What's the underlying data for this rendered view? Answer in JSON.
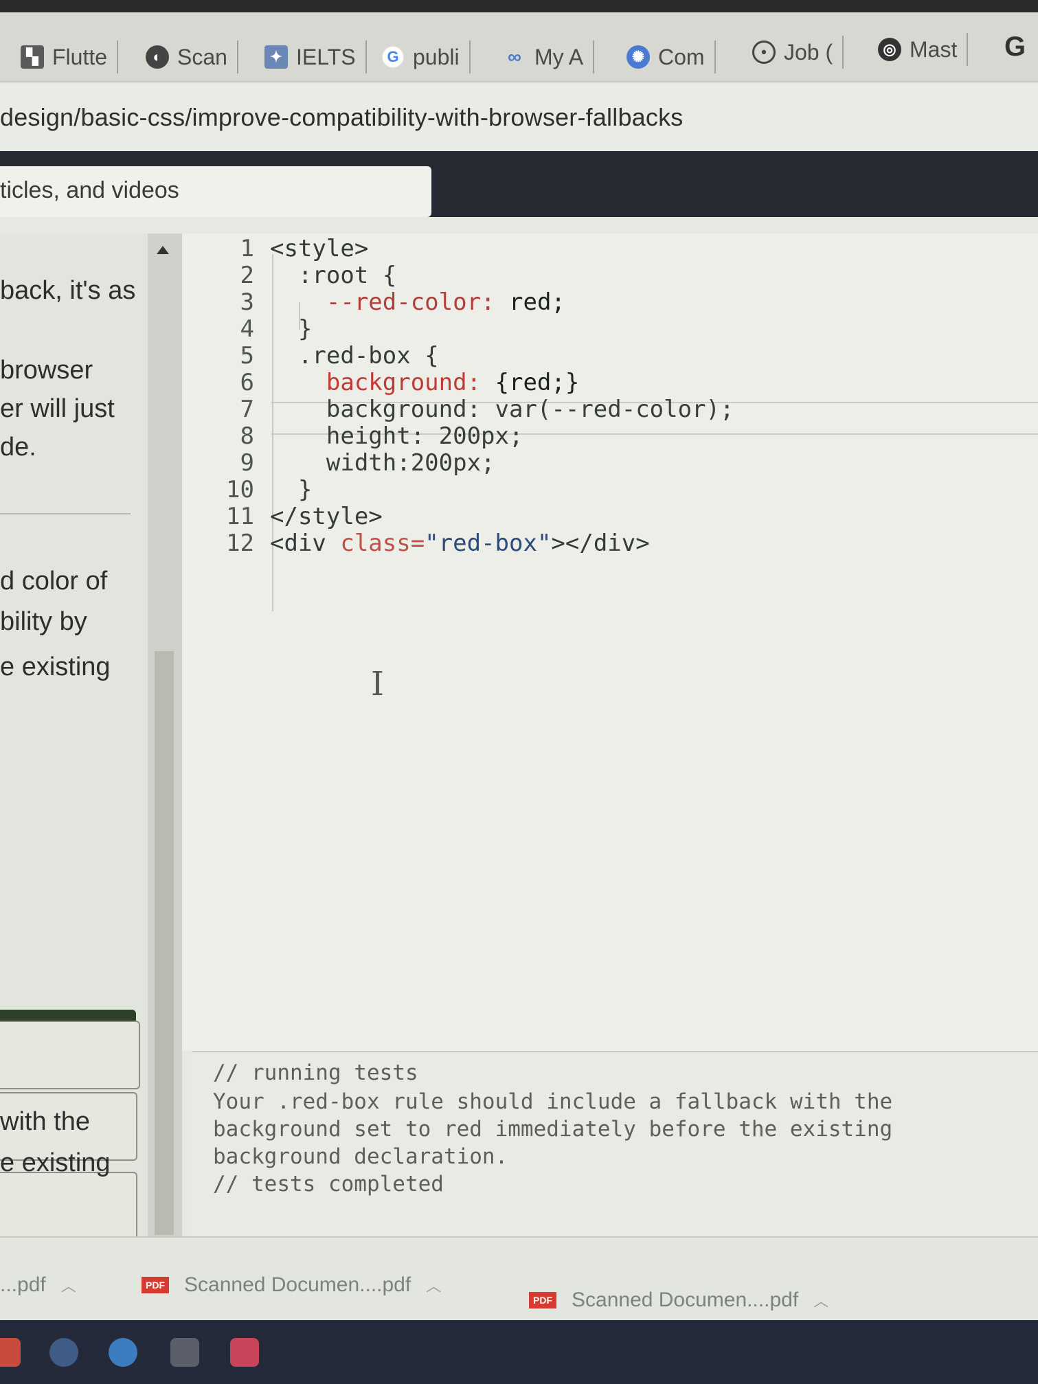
{
  "bookmarks": [
    {
      "label": "Flutte",
      "icon": "flutter-icon"
    },
    {
      "label": "Scan",
      "icon": "globe-icon"
    },
    {
      "label": "IELTS",
      "icon": "ielts-icon"
    },
    {
      "label": "publi",
      "icon": "google-icon"
    },
    {
      "label": "My A",
      "icon": "infinity-icon"
    },
    {
      "label": "Com",
      "icon": "gear-badge-icon"
    },
    {
      "label": "Job (",
      "icon": "circle-icon"
    },
    {
      "label": "Mast",
      "icon": "badge-icon"
    }
  ],
  "overflow_bookmark_icon": "G",
  "address_bar": {
    "url": "design/basic-css/improve-compatibility-with-browser-fallbacks"
  },
  "search": {
    "placeholder": "ticles, and videos"
  },
  "instructions": {
    "lines": [
      "back, it's as",
      "browser",
      "er will just",
      "de.",
      "d color of",
      "bility by",
      "e existing",
      "with the",
      "e existing"
    ]
  },
  "editor": {
    "lines": [
      {
        "n": "1",
        "parts": [
          {
            "t": "<style>",
            "c": "t-tag"
          }
        ]
      },
      {
        "n": "2",
        "parts": [
          {
            "t": "  :root {",
            "c": "t-sel"
          }
        ]
      },
      {
        "n": "3",
        "parts": [
          {
            "t": "    --red-color: ",
            "c": "t-var"
          },
          {
            "t": "red;",
            "c": "t-val"
          }
        ]
      },
      {
        "n": "4",
        "parts": [
          {
            "t": "  }",
            "c": "t-sel"
          }
        ]
      },
      {
        "n": "5",
        "parts": [
          {
            "t": "  .red-box {",
            "c": "t-sel"
          }
        ]
      },
      {
        "n": "6",
        "parts": [
          {
            "t": "    background: ",
            "c": "t-err"
          },
          {
            "t": "{red;}",
            "c": "t-val"
          }
        ]
      },
      {
        "n": "7",
        "parts": [
          {
            "t": "    background: var(--red-color);",
            "c": "t-prop"
          }
        ]
      },
      {
        "n": "8",
        "parts": [
          {
            "t": "    height: 200px;",
            "c": "t-prop"
          }
        ]
      },
      {
        "n": "9",
        "parts": [
          {
            "t": "    width:200px;",
            "c": "t-prop"
          }
        ]
      },
      {
        "n": "10",
        "parts": [
          {
            "t": "  }",
            "c": "t-sel"
          }
        ]
      },
      {
        "n": "11",
        "parts": [
          {
            "t": "</style>",
            "c": "t-tag"
          }
        ]
      },
      {
        "n": "12",
        "parts": [
          {
            "t": "<div ",
            "c": "t-tag"
          },
          {
            "t": "class=",
            "c": "t-attr"
          },
          {
            "t": "\"red-box\"",
            "c": "t-str"
          },
          {
            "t": "></div>",
            "c": "t-tag"
          }
        ]
      }
    ]
  },
  "console": {
    "start": "// running tests",
    "message_lines": [
      "Your .red-box rule should include a fallback with the",
      "background set to red immediately before the existing",
      "background declaration."
    ],
    "end": "// tests completed"
  },
  "downloads": [
    {
      "name": "...pdf"
    },
    {
      "name": "Scanned Documen....pdf",
      "badge": "PDF"
    },
    {
      "name": "Scanned Documen....pdf",
      "badge": "PDF"
    }
  ],
  "colors": {
    "accent_dark_green": "#2d4127",
    "error_red": "#c13a36",
    "nav_dark": "#262b33"
  }
}
